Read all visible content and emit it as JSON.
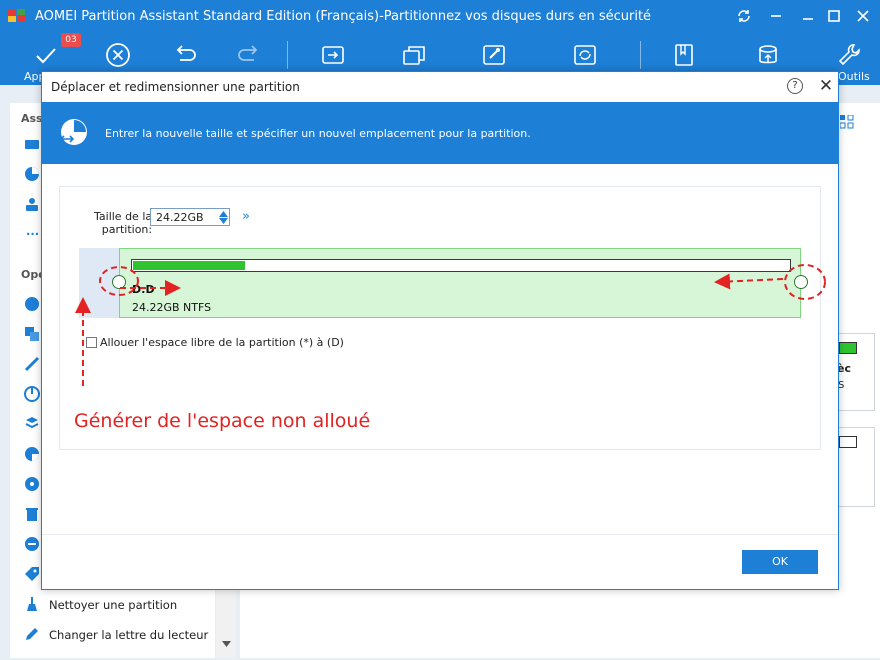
{
  "window": {
    "title": "AOMEI Partition Assistant Standard Edition (Français)-Partitionnez vos disques durs en sécurité"
  },
  "toolbar": {
    "pending_count": "03",
    "apply_label_partial": "App",
    "tools_label_partial": "Outils"
  },
  "left_panel": {
    "section1_partial": "Ass",
    "section2_partial": "Opé",
    "items": [
      {
        "label": "Nettoyer une partition",
        "icon": "broom-icon"
      },
      {
        "label": "Changer la lettre du lecteur",
        "icon": "pencil-icon"
      }
    ]
  },
  "right_panel": {
    "card_text_1": "èc",
    "card_text_2": "S"
  },
  "dialog": {
    "title": "Déplacer et redimensionner une partition",
    "header_text": "Entrer la nouvelle taille et spécifier un nouvel emplacement pour la partition.",
    "size_label_line1": "Taille de la",
    "size_label_line2": "partition:",
    "size_value": "24.22GB",
    "partition": {
      "name": "D:D",
      "info": "24.22GB NTFS",
      "used_fraction": 0.17
    },
    "checkbox_label": "Allouer l'espace libre de la partition (*) à (D)",
    "checkbox_checked": false,
    "annotation": "Générer de l'espace non alloué",
    "ok_label": "OK"
  },
  "colors": {
    "brand_blue": "#1e7fd6",
    "partition_green": "#d7f6d7",
    "usage_green": "#2fc42f",
    "annotation_red": "#e32222"
  }
}
